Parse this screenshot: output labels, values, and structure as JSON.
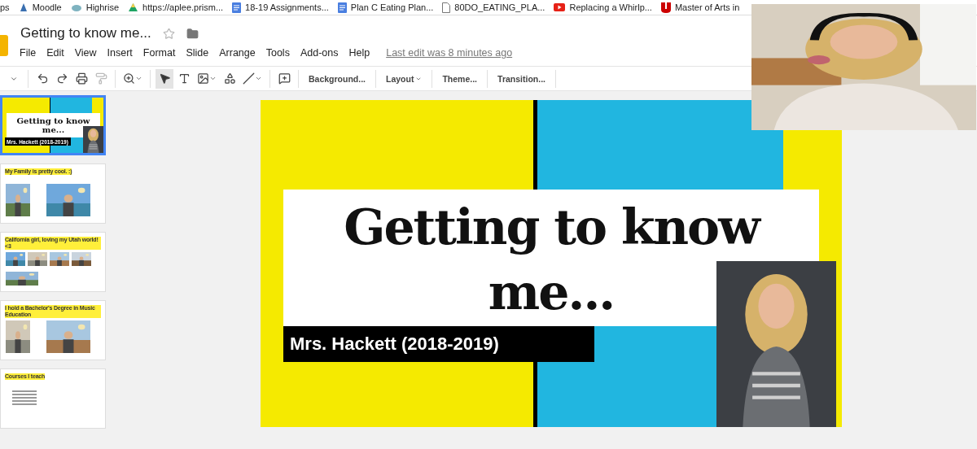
{
  "bookmarks": [
    {
      "label": "ps",
      "kind": "none"
    },
    {
      "label": "Moodle",
      "kind": "moodle"
    },
    {
      "label": "Highrise",
      "kind": "highrise"
    },
    {
      "label": "https://aplee.prism...",
      "kind": "drive"
    },
    {
      "label": "18-19 Assignments...",
      "kind": "doc"
    },
    {
      "label": "Plan C Eating Plan...",
      "kind": "doc"
    },
    {
      "label": "80DO_EATING_PLA...",
      "kind": "file"
    },
    {
      "label": "Replacing a Whirlp...",
      "kind": "youtube"
    },
    {
      "label": "Master of Arts in",
      "kind": "u"
    }
  ],
  "document": {
    "title": "Getting to know me...",
    "starred": false,
    "last_edit": "Last edit was 8 minutes ago"
  },
  "menu": [
    "File",
    "Edit",
    "View",
    "Insert",
    "Format",
    "Slide",
    "Arrange",
    "Tools",
    "Add-ons",
    "Help"
  ],
  "toolbar": {
    "text_buttons": [
      {
        "label": "Background...",
        "dropdown": false
      },
      {
        "label": "Layout",
        "dropdown": true
      },
      {
        "label": "Theme...",
        "dropdown": false
      },
      {
        "label": "Transition...",
        "dropdown": false
      }
    ]
  },
  "slides": [
    {
      "kind": "title",
      "selected": true,
      "title": "Getting to know me...",
      "subtitle": "Mrs. Hackett (2018-2019)"
    },
    {
      "kind": "pair",
      "selected": false,
      "heading": "My Family is pretty cool. :)"
    },
    {
      "kind": "collage",
      "selected": false,
      "heading": "California girl, loving my Utah world! <3"
    },
    {
      "kind": "pair",
      "selected": false,
      "heading": "I hold a Bachelor's Degree in Music Education"
    },
    {
      "kind": "list",
      "selected": false,
      "heading": "Courses I teach"
    }
  ],
  "main_slide": {
    "title": "Getting to know me...",
    "subtitle": "Mrs. Hackett (2018-2019)"
  }
}
